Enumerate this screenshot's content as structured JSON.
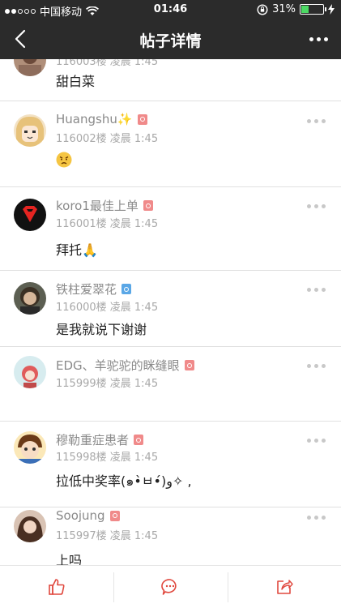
{
  "status_bar": {
    "carrier": "中国移动",
    "time": "01:46",
    "battery_percent": "31%",
    "battery_level": 0.31,
    "signal_dots_filled": 2,
    "signal_dots_total": 5
  },
  "nav": {
    "title": "帖子详情",
    "back_icon": "back-chevron-icon",
    "more_icon": "more-dots-icon"
  },
  "colors": {
    "header_bg": "#2b2b2b",
    "badge_female": "#f08a8a",
    "badge_male": "#5aa7e6",
    "accent_red": "#e0483e"
  },
  "posts": [
    {
      "floor_meta": "116003楼 凌晨 1:45",
      "content": "甜白菜"
    },
    {
      "username": "Huangshu✨",
      "gender": "female",
      "floor_meta": "116002楼 凌晨 1:45",
      "content": ""
    },
    {
      "username": "koro1最佳上单",
      "gender": "female",
      "floor_meta": "116001楼 凌晨 1:45",
      "content": "拜托🙏"
    },
    {
      "username": "铁柱爱翠花",
      "gender": "male",
      "floor_meta": "116000楼 凌晨 1:45",
      "content": "是我就说下谢谢"
    },
    {
      "username": "EDG、羊驼驼的眯缝眼",
      "gender": "female",
      "floor_meta": "115999楼 凌晨 1:45",
      "content": ""
    },
    {
      "username": "穆勒重症患者",
      "gender": "female",
      "floor_meta": "115998楼 凌晨 1:45",
      "content": "拉低中奖率(๑•̀ㅂ•́)و✧ ,"
    },
    {
      "username": "Soojung",
      "gender": "female",
      "floor_meta": "115997楼 凌晨 1:45",
      "content": "上吗"
    }
  ],
  "bottom_bar": {
    "like_icon": "thumbs-up-icon",
    "comment_icon": "comment-icon",
    "share_icon": "share-icon"
  }
}
